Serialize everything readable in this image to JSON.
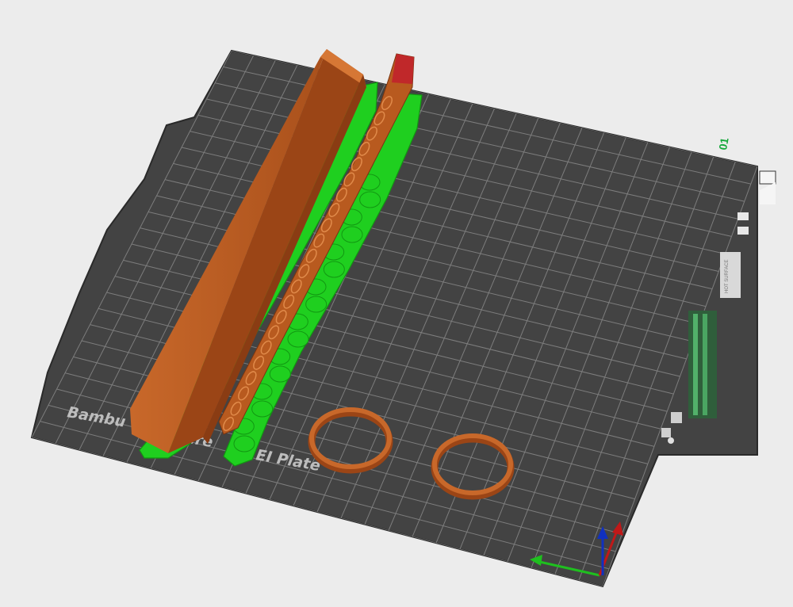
{
  "app": {
    "view": "3D Prepare View"
  },
  "plate": {
    "index_label": "01",
    "brand_text": "Bambu Textured PEI Plate",
    "brand_visible_part1": "Bambu",
    "brand_visible_part2": "ure",
    "brand_visible_part3": "EI Plate",
    "surface_tag": "HOT SURFACE",
    "colors": {
      "plate": "#444444",
      "grid": "#8a8a8a",
      "background": "#ececec"
    }
  },
  "objects": [
    {
      "name": "long-beam",
      "color": "#b85a1f"
    },
    {
      "name": "chain-part",
      "color": "#b85a1f",
      "support_color": "#1fd11f"
    },
    {
      "name": "ring-left",
      "color": "#b85a1f"
    },
    {
      "name": "ring-right",
      "color": "#b85a1f"
    }
  ],
  "axes": {
    "x_color": "#1fbf1f",
    "y_color": "#c01818",
    "z_color": "#1030c0"
  }
}
